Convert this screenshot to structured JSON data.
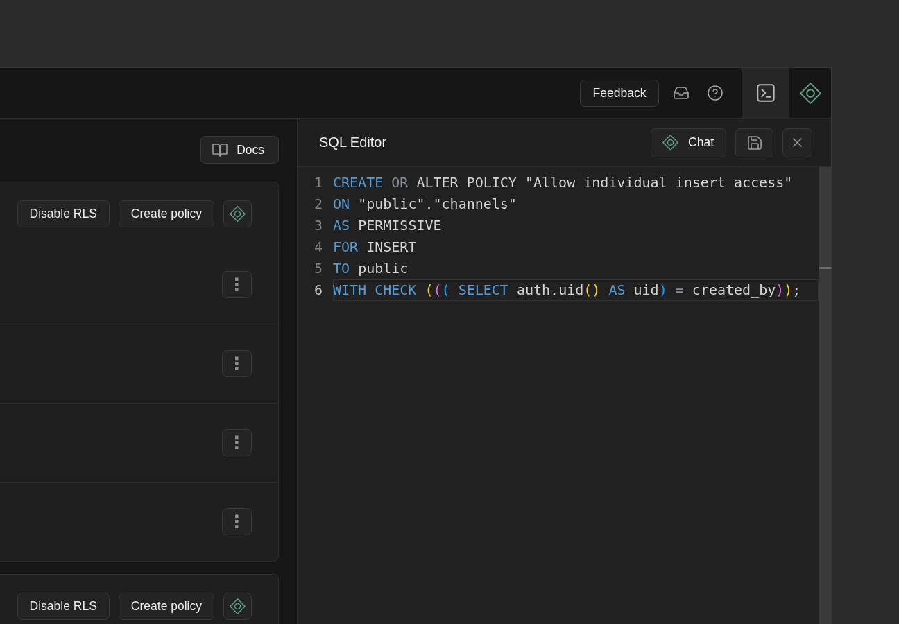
{
  "top_bar": {
    "feedback_button": "Feedback",
    "icons": [
      {
        "kind": "inbox"
      },
      {
        "kind": "help"
      }
    ],
    "panels": [
      {
        "kind": "terminal",
        "selected": true
      },
      {
        "kind": "assistant",
        "selected": false
      }
    ]
  },
  "policies_panel": {
    "docs_button": "Docs",
    "tables": [
      {
        "actions": [
          "Disable RLS",
          "Create policy"
        ],
        "policies": [
          {
            "menu": "⋮"
          },
          {
            "menu": "⋮"
          },
          {
            "menu": "⋮"
          },
          {
            "menu": "⋮"
          }
        ]
      },
      {
        "actions": [
          "Disable RLS",
          "Create policy"
        ]
      }
    ]
  },
  "sql_editor": {
    "title": "SQL Editor",
    "chat_button": "Chat",
    "actions": [
      {
        "kind": "save"
      },
      {
        "kind": "close"
      }
    ],
    "lines": [
      {
        "number": "1",
        "current": false,
        "tokens": [
          {
            "kind": "keyword",
            "text": "CREATE"
          },
          {
            "kind": "muted",
            "text": " OR"
          },
          {
            "kind": "plain",
            "text": " ALTER POLICY \"Allow individual insert access\""
          }
        ]
      },
      {
        "number": "2",
        "current": false,
        "tokens": [
          {
            "kind": "keyword",
            "text": "ON"
          },
          {
            "kind": "plain",
            "text": " \"public\".\"channels\""
          }
        ]
      },
      {
        "number": "3",
        "current": false,
        "tokens": [
          {
            "kind": "keyword",
            "text": "AS"
          },
          {
            "kind": "plain",
            "text": " PERMISSIVE"
          }
        ]
      },
      {
        "number": "4",
        "current": false,
        "tokens": [
          {
            "kind": "keyword",
            "text": "FOR"
          },
          {
            "kind": "plain",
            "text": " INSERT"
          }
        ]
      },
      {
        "number": "5",
        "current": false,
        "tokens": [
          {
            "kind": "keyword",
            "text": "TO"
          },
          {
            "kind": "plain",
            "text": " public"
          }
        ]
      },
      {
        "number": "6",
        "current": true,
        "tokens": [
          {
            "kind": "keyword",
            "text": "WITH CHECK "
          },
          {
            "kind": "bracket",
            "text": "(",
            "color": "#ffd700"
          },
          {
            "kind": "bracket",
            "text": "(",
            "color": "#da70d6"
          },
          {
            "kind": "bracket",
            "text": "(",
            "color": "#179fff"
          },
          {
            "kind": "keyword",
            "text": " SELECT"
          },
          {
            "kind": "plain",
            "text": " auth.uid"
          },
          {
            "kind": "bracket",
            "text": "()",
            "color": "#ffd700"
          },
          {
            "kind": "keyword",
            "text": " AS"
          },
          {
            "kind": "plain",
            "text": " uid"
          },
          {
            "kind": "bracket",
            "text": ")",
            "color": "#179fff"
          },
          {
            "kind": "muted",
            "text": " ="
          },
          {
            "kind": "plain",
            "text": " created_by"
          },
          {
            "kind": "bracket",
            "text": ")",
            "color": "#da70d6"
          },
          {
            "kind": "bracket",
            "text": ")",
            "color": "#ffd700"
          },
          {
            "kind": "plain",
            "text": ";"
          }
        ]
      }
    ]
  }
}
